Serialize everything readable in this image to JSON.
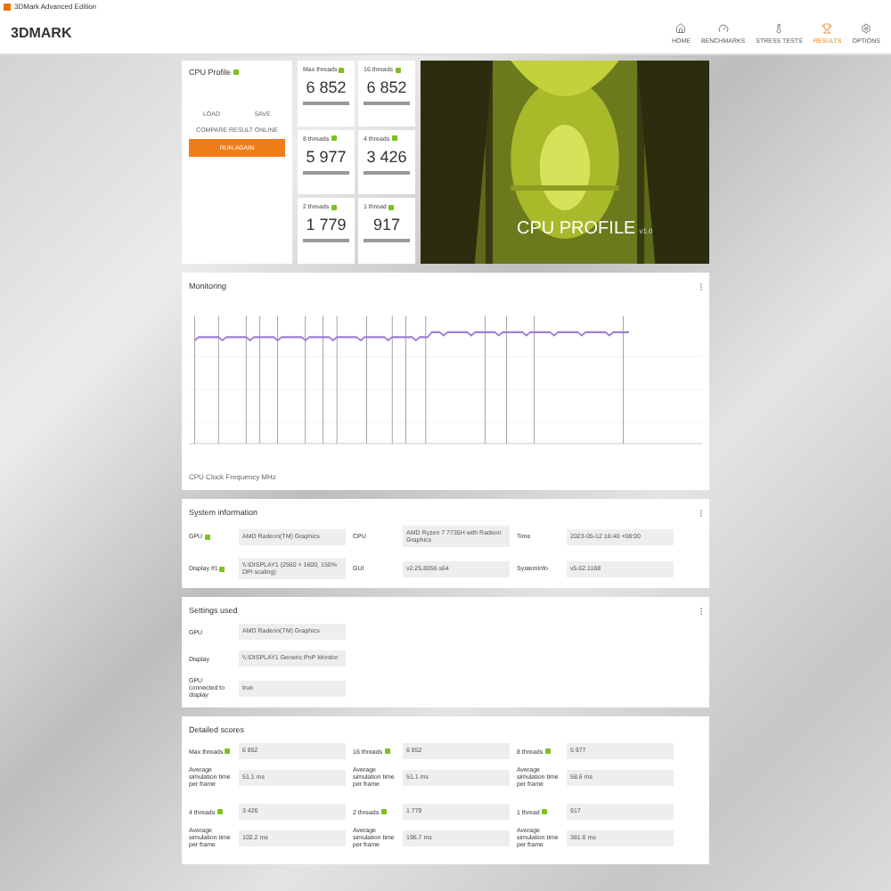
{
  "window": {
    "title": "3DMark Advanced Edition"
  },
  "header": {
    "logo": "3DMARK",
    "nav": [
      {
        "label": "HOME",
        "kind": "home",
        "selected": false
      },
      {
        "label": "BENCHMARKS",
        "kind": "gauge",
        "selected": false
      },
      {
        "label": "STRESS TESTS",
        "kind": "thermo",
        "selected": false
      },
      {
        "label": "RESULTS",
        "kind": "trophy",
        "selected": true
      },
      {
        "label": "OPTIONS",
        "kind": "gear",
        "selected": false
      }
    ]
  },
  "result_card": {
    "title": "CPU Profile",
    "buttons": [
      "LOAD",
      "SAVE"
    ],
    "compare": "COMPARE RESULT ONLINE",
    "run": "RUN AGAIN"
  },
  "scores": [
    {
      "label": "Max threads",
      "value": "6 852"
    },
    {
      "label": "16 threads",
      "value": "6 852"
    },
    {
      "label": "8 threads",
      "value": "5 977"
    },
    {
      "label": "4 threads",
      "value": "3 426"
    },
    {
      "label": "2 threads",
      "value": "1 779"
    },
    {
      "label": "1 thread",
      "value": "917"
    }
  ],
  "hero": {
    "title": "CPU PROFILE",
    "version": "v1.0"
  },
  "monitoring": {
    "title": "Monitoring",
    "legend": "CPU Clock Frequency MHz"
  },
  "system_information": {
    "title": "System information",
    "fields": [
      {
        "label": "GPU",
        "value": "AMD Radeon(TM) Graphics",
        "info": true
      },
      {
        "label": "CPU",
        "value": "AMD Ryzen 7 7735H with Radeon Graphics",
        "info": false
      },
      {
        "label": "Time",
        "value": "2023-05-12 16:40 +08:00",
        "info": false
      },
      {
        "label": "Display #1",
        "value": "\\\\.\\DISPLAY1 (2560 × 1600, 150% DPI scaling)",
        "info": true
      },
      {
        "label": "GUI",
        "value": "v2.25.8056 s64",
        "info": false
      },
      {
        "label": "SystemInfo",
        "value": "v5.62.1188",
        "info": false
      }
    ]
  },
  "settings_used": {
    "title": "Settings used",
    "fields": [
      {
        "label": "GPU",
        "value": "AMD Radeon(TM) Graphics"
      },
      {
        "label": "Display",
        "value": "\\\\.\\DISPLAY1 Generic PnP Monitor"
      },
      {
        "label": "GPU connected to display",
        "value": "true"
      }
    ]
  },
  "detailed_scores": {
    "title": "Detailed scores",
    "groups": [
      {
        "label": "Max threads",
        "score": "6 852",
        "time_label": "Average simulation time per frame",
        "time": "51.1 ms"
      },
      {
        "label": "16 threads",
        "score": "6 852",
        "time_label": "Average simulation time per frame",
        "time": "51.1 ms"
      },
      {
        "label": "8 threads",
        "score": "5 977",
        "time_label": "Average simulation time per frame",
        "time": "58.6 ms"
      },
      {
        "label": "4 threads",
        "score": "3 426",
        "time_label": "Average simulation time per frame",
        "time": "102.2 ms"
      },
      {
        "label": "2 threads",
        "score": "1 779",
        "time_label": "Average simulation time per frame",
        "time": "196.7 ms"
      },
      {
        "label": "1 thread",
        "score": "917",
        "time_label": "Average simulation time per frame",
        "time": "381.6 ms"
      }
    ]
  }
}
